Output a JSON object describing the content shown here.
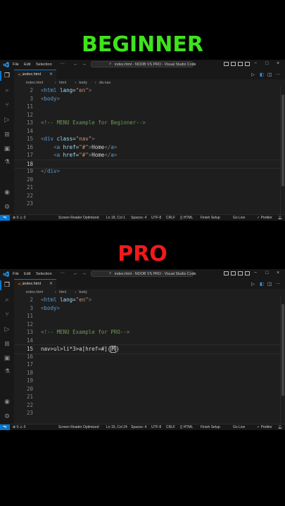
{
  "headings": {
    "beginner": "BEGINNER",
    "pro": "PRO"
  },
  "panes": [
    {
      "titlebar": {
        "menu": [
          "File",
          "Edit",
          "Selection"
        ],
        "more": "···",
        "search_text": "index.html - NOOB VS PRO - Visual Studio Code"
      },
      "tab": {
        "label": "index.html",
        "close": "×"
      },
      "breadcrumb": [
        "index.html",
        "html",
        "body",
        "div.nav"
      ],
      "lines": [
        {
          "n": "2",
          "html": "<span class='c-br'>&lt;</span><span class='c-tag'>html</span> <span class='c-attr'>lang</span>=<span class='c-str'>\"en\"</span><span class='c-br'>&gt;</span>"
        },
        {
          "n": "3",
          "html": "<span class='c-br'>&lt;</span><span class='c-tag'>body</span><span class='c-br'>&gt;</span>"
        },
        {
          "n": "11",
          "html": ""
        },
        {
          "n": "12",
          "html": ""
        },
        {
          "n": "13",
          "html": "<span class='c-com'>&lt;!-- MENU Example for Beginner--&gt;</span>"
        },
        {
          "n": "14",
          "html": ""
        },
        {
          "n": "15",
          "html": "<span class='c-br'>&lt;</span><span class='c-tag'>div</span> <span class='c-attr'>class</span>=<span class='c-str'>\"nav\"</span><span class='c-br'>&gt;</span>"
        },
        {
          "n": "16",
          "html": "    <span class='c-br'>&lt;</span><span class='c-tag'>a</span> <span class='c-attr'>href</span>=<span class='c-str'>\"#\"</span><span class='c-br'>&gt;</span>Home<span class='c-br'>&lt;/</span><span class='c-tag'>a</span><span class='c-br'>&gt;</span>"
        },
        {
          "n": "17",
          "html": "    <span class='c-br'>&lt;</span><span class='c-tag'>a</span> <span class='c-attr'>href</span>=<span class='c-str'>\"#\"</span><span class='c-br'>&gt;</span>Home<span class='c-br'>&lt;/</span><span class='c-tag'>a</span><span class='c-br'>&gt;</span>"
        },
        {
          "n": "18",
          "html": "",
          "current": true
        },
        {
          "n": "19",
          "html": "<span class='c-br'>&lt;/</span><span class='c-tag'>div</span><span class='c-br'>&gt;</span>"
        },
        {
          "n": "20",
          "html": ""
        },
        {
          "n": "21",
          "html": ""
        },
        {
          "n": "22",
          "html": ""
        },
        {
          "n": "23",
          "html": ""
        }
      ],
      "status": {
        "errors": "⊗ 0 ⚠ 0",
        "screen_reader": "Screen Reader Optimized",
        "position": "Ln 18, Col 1",
        "spaces": "Spaces: 4",
        "encoding": "UTF-8",
        "eol": "CRLF",
        "language": "{} HTML",
        "finish_setup": "Finish Setup",
        "go_live": "Go Live",
        "prettier": "✓ Prettier"
      }
    },
    {
      "titlebar": {
        "menu": [
          "File",
          "Edit",
          "Selection"
        ],
        "more": "···",
        "search_text": "index.html - NOOB VS PRO - Visual Studio Code"
      },
      "tab": {
        "label": "index.html",
        "close": "×"
      },
      "breadcrumb": [
        "index.html",
        "html",
        "body"
      ],
      "lines": [
        {
          "n": "2",
          "html": "<span class='c-br'>&lt;</span><span class='c-tag'>html</span> <span class='c-attr'>lang</span>=<span class='c-str'>\"en\"</span><span class='c-br'>&gt;</span>"
        },
        {
          "n": "3",
          "html": "<span class='c-br'>&lt;</span><span class='c-tag'>body</span><span class='c-br'>&gt;</span>"
        },
        {
          "n": "11",
          "html": ""
        },
        {
          "n": "12",
          "html": ""
        },
        {
          "n": "13",
          "html": "<span class='c-com'>&lt;!-- MENU Example for PRO--&gt;</span>"
        },
        {
          "n": "14",
          "html": ""
        },
        {
          "n": "15",
          "html": "<span class='c-txt'>nav&gt;ul&gt;li*3&gt;a[href=#]{</span><span class='cursor-box'>M</span><span class='c-txt'>}</span>",
          "current": true
        },
        {
          "n": "16",
          "html": ""
        },
        {
          "n": "17",
          "html": ""
        },
        {
          "n": "18",
          "html": ""
        },
        {
          "n": "19",
          "html": ""
        },
        {
          "n": "20",
          "html": ""
        },
        {
          "n": "21",
          "html": ""
        },
        {
          "n": "22",
          "html": ""
        },
        {
          "n": "23",
          "html": ""
        }
      ],
      "status": {
        "errors": "⊗ 0 ⚠ 0",
        "screen_reader": "Screen Reader Optimized",
        "position": "Ln 15, Col 24",
        "spaces": "Spaces: 4",
        "encoding": "UTF-8",
        "eol": "CRLF",
        "language": "{} HTML",
        "finish_setup": "Finish Setup",
        "go_live": "Go Live",
        "prettier": "✓ Prettier"
      }
    }
  ],
  "icons": {
    "explorer": "explorer-icon",
    "search": "search-icon",
    "source_control": "source-control-icon",
    "run": "run-debug-icon",
    "extensions": "extensions-icon",
    "account": "account-icon",
    "settings": "gear-icon"
  },
  "colors": {
    "beginner": "#3fe31d",
    "pro": "#f01a1a",
    "accent": "#0078d4"
  }
}
